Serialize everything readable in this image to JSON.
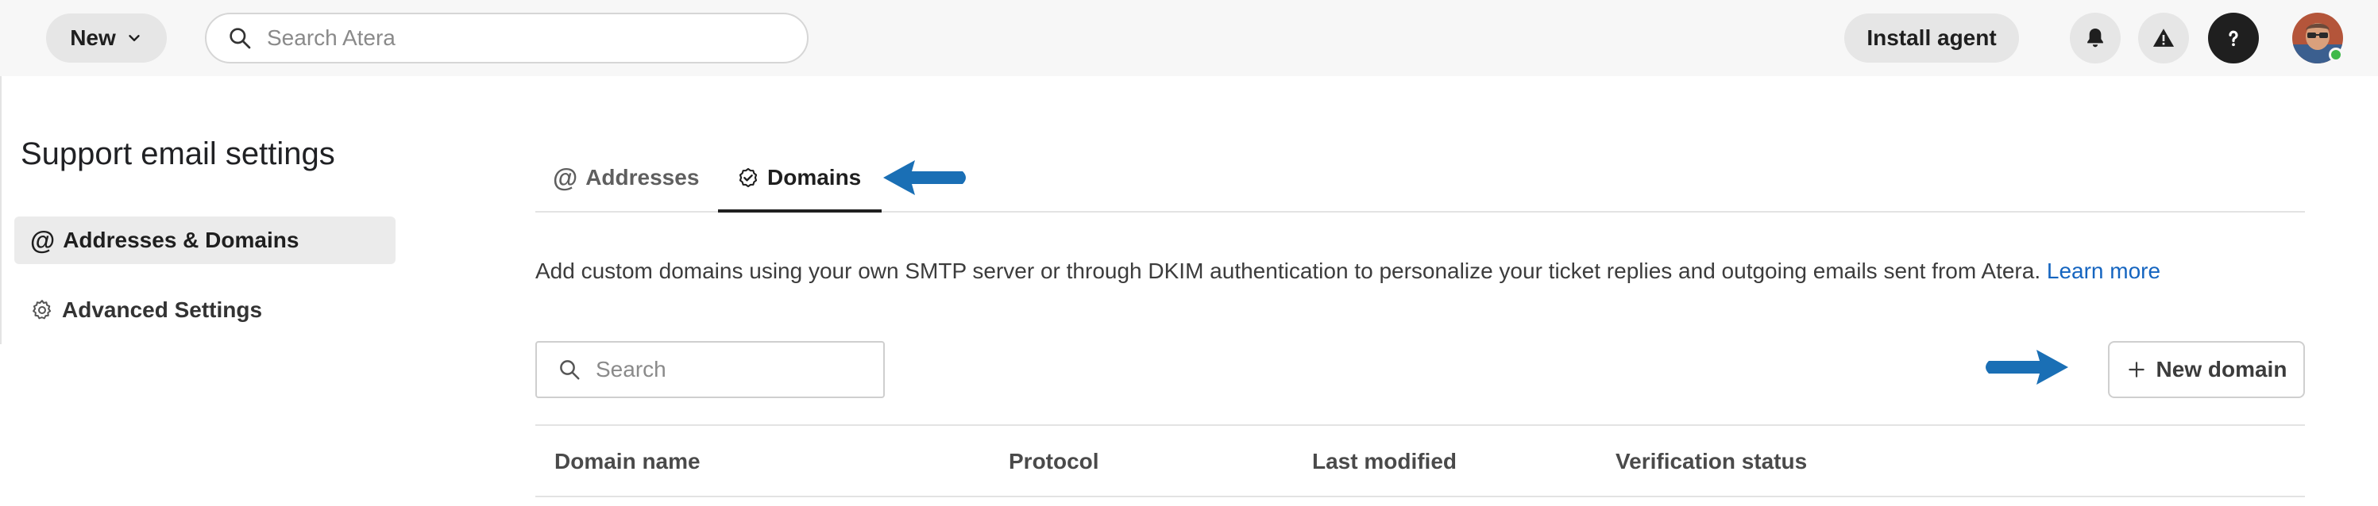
{
  "header": {
    "new_label": "New",
    "search_placeholder": "Search Atera",
    "install_label": "Install agent"
  },
  "sidebar": {
    "title": "Support email settings",
    "items": [
      {
        "label": "Addresses & Domains",
        "icon": "at-icon",
        "active": true
      },
      {
        "label": "Advanced Settings",
        "icon": "gear-icon",
        "active": false
      }
    ]
  },
  "tabs": [
    {
      "label": "Addresses",
      "icon": "at-icon",
      "active": false
    },
    {
      "label": "Domains",
      "icon": "verified-badge-icon",
      "active": true
    }
  ],
  "description": {
    "text": "Add custom domains using your own SMTP server or through DKIM authentication to personalize your ticket replies and outgoing emails sent from Atera.",
    "link": "Learn more"
  },
  "toolbar": {
    "search_placeholder": "Search",
    "new_domain_label": "New domain"
  },
  "table": {
    "columns": [
      "Domain name",
      "Protocol",
      "Last modified",
      "Verification status"
    ]
  },
  "colors": {
    "accent_link": "#1565c0",
    "arrow": "#1a6fb5",
    "status_online": "#3fb94a"
  }
}
